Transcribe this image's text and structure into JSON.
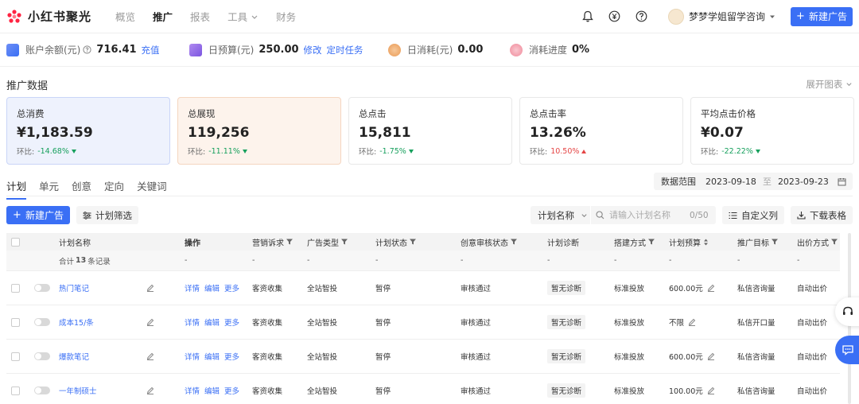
{
  "brand": {
    "name": "小红书聚光",
    "color": "#ff2442"
  },
  "nav": [
    {
      "label": "概览"
    },
    {
      "label": "推广"
    },
    {
      "label": "报表"
    },
    {
      "label": "工具"
    },
    {
      "label": "财务"
    }
  ],
  "header": {
    "account_name": "梦梦学姐留学咨询",
    "new_ad_label": "新建广告",
    "icons": [
      "bell-icon",
      "yen-icon",
      "help-icon"
    ]
  },
  "accent": "#3a6ff5",
  "account_info": {
    "balance_label": "账户余额(元)",
    "balance_value": "716.41",
    "recharge_link": "充值",
    "budget_label": "日预算(元)",
    "budget_value": "250.00",
    "budget_edit": "修改",
    "budget_task": "定时任务",
    "spend_label": "日消耗(元)",
    "spend_value": "0.00",
    "progress_label": "消耗进度",
    "progress_value": "0%"
  },
  "section": {
    "title": "推广数据",
    "expand_label": "展开图表"
  },
  "cards": [
    {
      "label": "总消费",
      "value": "¥1,183.59",
      "compare_label": "环比:",
      "compare_value": "-14.68%",
      "trend": "down"
    },
    {
      "label": "总展现",
      "value": "119,256",
      "compare_label": "环比:",
      "compare_value": "-11.11%",
      "trend": "down"
    },
    {
      "label": "总点击",
      "value": "15,811",
      "compare_label": "环比:",
      "compare_value": "-1.75%",
      "trend": "down"
    },
    {
      "label": "总点击率",
      "value": "13.26%",
      "compare_label": "环比:",
      "compare_value": "10.50%",
      "trend": "up"
    },
    {
      "label": "平均点击价格",
      "value": "¥0.07",
      "compare_label": "环比:",
      "compare_value": "-22.22%",
      "trend": "down"
    }
  ],
  "tabs": [
    {
      "label": "计划"
    },
    {
      "label": "单元"
    },
    {
      "label": "创意"
    },
    {
      "label": "定向"
    },
    {
      "label": "关键词"
    }
  ],
  "date_range": {
    "label": "数据范围",
    "start": "2023-09-18",
    "sep": "至",
    "end": "2023-09-23"
  },
  "toolbar": {
    "new_ad_label": "新建广告",
    "filter_label": "计划筛选",
    "search_field": "计划名称",
    "search_placeholder": "请输入计划名称",
    "search_count": "0/50",
    "custom_cols_label": "自定义列",
    "download_label": "下载表格"
  },
  "table": {
    "headers": {
      "name": "计划名称",
      "ops": "操作",
      "marketing": "营销诉求",
      "ad_type": "广告类型",
      "status": "计划状态",
      "review": "创意审核状态",
      "diagnosis": "计划诊断",
      "delivery": "搭建方式",
      "budget": "计划预算",
      "target": "推广目标",
      "bid": "出价方式"
    },
    "summary": {
      "prefix": "合计",
      "count": "13",
      "suffix": "条记录",
      "dash": "-"
    },
    "op_labels": {
      "detail": "详情",
      "edit": "编辑",
      "more": "更多"
    },
    "rows": [
      {
        "name": "热门笔记",
        "marketing": "客资收集",
        "ad_type": "全站智投",
        "status": "暂停",
        "review": "审核通过",
        "diagnosis": "暂无诊断",
        "delivery": "标准投放",
        "budget": "600.00元",
        "target": "私信咨询量",
        "bid": "自动出价"
      },
      {
        "name": "成本15/条",
        "marketing": "客资收集",
        "ad_type": "全站智投",
        "status": "暂停",
        "review": "审核通过",
        "diagnosis": "暂无诊断",
        "delivery": "标准投放",
        "budget": "不限",
        "target": "私信开口量",
        "bid": "自动出价"
      },
      {
        "name": "爆款笔记",
        "marketing": "客资收集",
        "ad_type": "全站智投",
        "status": "暂停",
        "review": "审核通过",
        "diagnosis": "暂无诊断",
        "delivery": "标准投放",
        "budget": "600.00元",
        "target": "私信咨询量",
        "bid": "自动出价"
      },
      {
        "name": "一年制硕士",
        "marketing": "客资收集",
        "ad_type": "全站智投",
        "status": "暂停",
        "review": "审核通过",
        "diagnosis": "暂无诊断",
        "delivery": "标准投放",
        "budget": "100.00元",
        "target": "私信咨询量",
        "bid": "自动出价"
      }
    ]
  }
}
